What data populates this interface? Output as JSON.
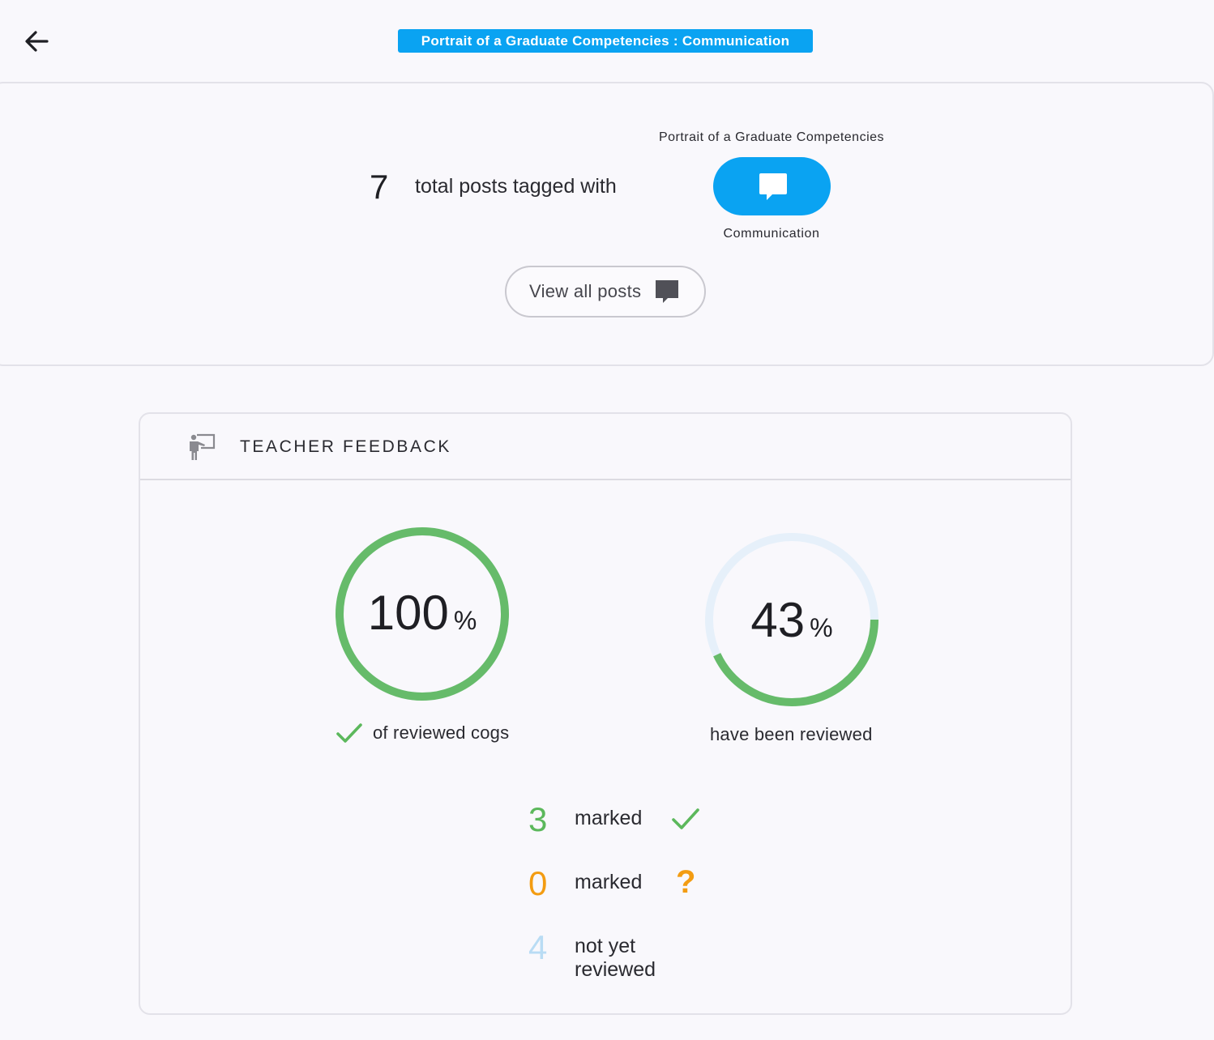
{
  "header": {
    "back_icon": "arrow-left-icon",
    "title": "Portrait of a Graduate Competencies : Communication",
    "title_color": "#0aa3f2"
  },
  "summary": {
    "total_count": "7",
    "total_text": "total posts tagged with",
    "group_label": "Portrait of a Graduate Competencies",
    "tag_icon": "speech-bubble-icon",
    "tag_name": "Communication",
    "view_all_label": "View all posts",
    "view_all_icon": "comment-icon"
  },
  "feedback": {
    "title": "TEACHER FEEDBACK",
    "header_icon": "teacher-board-icon",
    "reviewed_cogs": {
      "percent": 100,
      "value_text": "100",
      "unit": "%",
      "caption": "of reviewed cogs",
      "caption_icon": "check-icon"
    },
    "reviewed_posts": {
      "percent": 43,
      "value_text": "43",
      "unit": "%",
      "caption": "have been reviewed"
    },
    "stats": [
      {
        "count": "3",
        "label": "marked",
        "icon": "check-icon",
        "color": "#5cb85c"
      },
      {
        "count": "0",
        "label": "marked",
        "icon": "question-icon",
        "color": "#f39c12"
      },
      {
        "count": "4",
        "label": "not yet reviewed",
        "icon": "",
        "color": "#b9dcf4"
      }
    ]
  },
  "colors": {
    "accent": "#0aa3f2",
    "progress_green": "#66bb6a",
    "track_light": "#e6f0fa",
    "check_green": "#5cb85c",
    "question_orange": "#f39c12",
    "pending_blue": "#b9dcf4"
  }
}
